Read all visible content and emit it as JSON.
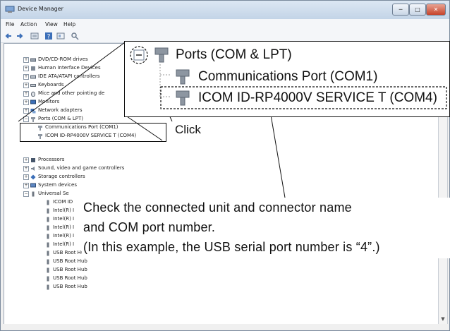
{
  "window": {
    "title": "Device Manager",
    "buttons": {
      "minimize": "─",
      "maximize": "□",
      "close": "✕"
    }
  },
  "menu": [
    "File",
    "Action",
    "View",
    "Help"
  ],
  "tree": {
    "items": [
      {
        "label": "DVD/CD-ROM drives",
        "icon": "disk-drive-icon"
      },
      {
        "label": "Human Interface Devices",
        "icon": "hid-icon"
      },
      {
        "label": "IDE ATA/ATAPI controllers",
        "icon": "ide-icon"
      },
      {
        "label": "Keyboards",
        "icon": "keyboard-icon"
      },
      {
        "label": "Mice and other pointing de",
        "icon": "mouse-icon"
      },
      {
        "label": "Monitors",
        "icon": "monitor-icon"
      },
      {
        "label": "Network adapters",
        "icon": "network-icon"
      },
      {
        "label": "Ports (COM & LPT)",
        "icon": "port-icon"
      },
      {
        "label": "Communications Port (COM1)",
        "icon": "port-icon"
      },
      {
        "label": "ICOM ID-RP4000V SERVICE T (COM4)",
        "icon": "port-icon"
      },
      {
        "label": "Processors",
        "icon": "processor-icon"
      },
      {
        "label": "Sound, video and game controllers",
        "icon": "sound-icon"
      },
      {
        "label": "Storage controllers",
        "icon": "storage-icon"
      },
      {
        "label": "System devices",
        "icon": "system-icon"
      },
      {
        "label": "Universal Se",
        "icon": "usb-icon"
      },
      {
        "label": "ICOM ID",
        "icon": "usb-icon"
      },
      {
        "label": "Intel(R) I",
        "icon": "usb-icon"
      },
      {
        "label": "Intel(R) I",
        "icon": "usb-icon"
      },
      {
        "label": "Intel(R) I",
        "icon": "usb-icon"
      },
      {
        "label": "Intel(R) I",
        "icon": "usb-icon"
      },
      {
        "label": "Intel(R) I",
        "icon": "usb-icon"
      },
      {
        "label": "USB Root Hub",
        "icon": "usb-icon"
      },
      {
        "label": "USB Root Hub",
        "icon": "usb-icon"
      },
      {
        "label": "USB Root Hub",
        "icon": "usb-icon"
      },
      {
        "label": "USB Root Hub",
        "icon": "usb-icon"
      },
      {
        "label": "USB Root Hub",
        "icon": "usb-icon"
      }
    ]
  },
  "zoom": {
    "ports": "Ports (COM & LPT)",
    "comm_port": "Communications Port (COM1)",
    "icom_port": "ICOM ID-RP4000V SERVICE T (COM4)"
  },
  "annotations": {
    "click": "Click",
    "line1": "Check the connected unit and connector name",
    "line2": "and COM port number.",
    "line3": "(In this example, the USB serial port number is “4”.)"
  },
  "colors": {
    "accent": "#2f6db5",
    "icon_blue": "#3c6fb8",
    "icon_gray": "#7d8794"
  }
}
